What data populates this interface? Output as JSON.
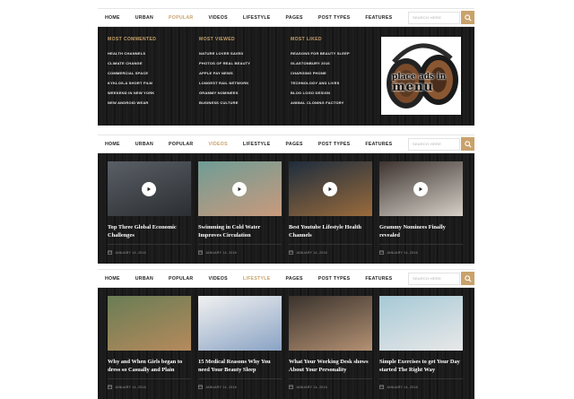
{
  "nav": {
    "items": [
      "Home",
      "Urban",
      "Popular",
      "Videos",
      "Lifestyle",
      "Pages",
      "Post Types",
      "Features"
    ],
    "search_placeholder": "Search here"
  },
  "panel1": {
    "active": "Popular",
    "columns": [
      {
        "title": "Most Commented",
        "items": [
          "Health Channels",
          "Climate Change",
          "Commercial Space",
          "Kyklos-A Short Film",
          "Weekend in New York",
          "New Android Wear"
        ]
      },
      {
        "title": "Most Viewed",
        "items": [
          "Nature Lover Saved",
          "Photos of Real Beauty",
          "Apple Pay News",
          "Longest Rail Network",
          "Grammy Nominees",
          "Business Culture"
        ]
      },
      {
        "title": "Most Liked",
        "items": [
          "Reasons for Beauty Sleep",
          "Glastonbury 2016",
          "Charging Phone",
          "Technology and Lives",
          "Blog Logo Design",
          "Animal Cloning Factory"
        ]
      }
    ],
    "ad": {
      "line1": "place ads in",
      "line2": "menu"
    }
  },
  "panel2": {
    "active": "Videos",
    "cards": [
      {
        "title": "Top Three Global Economic Challenges",
        "date": "January 14, 2016",
        "thumb_colors": [
          "#5a5f66",
          "#2b2f33"
        ],
        "icon": "play-icon"
      },
      {
        "title": "Swimming in Cold Water Improves Circulation",
        "date": "January 14, 2016",
        "thumb_colors": [
          "#6f9c95",
          "#c99a7c"
        ],
        "icon": "play-icon"
      },
      {
        "title": "Best Youtube Lifestyle Health Channels",
        "date": "January 14, 2016",
        "thumb_colors": [
          "#1e2d3e",
          "#9a6b3b"
        ],
        "icon": "play-icon"
      },
      {
        "title": "Grammy Nominees Finally revealed",
        "date": "January 14, 2016",
        "thumb_colors": [
          "#3e3430",
          "#d6d0c8"
        ],
        "icon": "play-icon"
      }
    ]
  },
  "panel3": {
    "active": "Lifestyle",
    "cards": [
      {
        "title": "Why and When Girls began to dress so Casually and Plain",
        "date": "January 14, 2016",
        "thumb_colors": [
          "#6a7d55",
          "#b58a5c"
        ]
      },
      {
        "title": "15 Medical Reasons Why You need Your Beauty Sleep",
        "date": "January 14, 2016",
        "thumb_colors": [
          "#f1f1f1",
          "#8aa3c4"
        ]
      },
      {
        "title": "What Your Working Desk shows About Your Personality",
        "date": "January 14, 2016",
        "thumb_colors": [
          "#3a332d",
          "#b49173"
        ]
      },
      {
        "title": "Simple Exercises to get Your Day started The Right Way",
        "date": "January 14, 2016",
        "thumb_colors": [
          "#a6c9d6",
          "#e8e8e8"
        ]
      }
    ]
  },
  "colors": {
    "accent": "#c9a26b",
    "dark": "#1b1b1b",
    "nav_text": "#222222"
  },
  "icons": {
    "search": "search-icon",
    "date": "calendar-icon",
    "play": "play-icon"
  }
}
